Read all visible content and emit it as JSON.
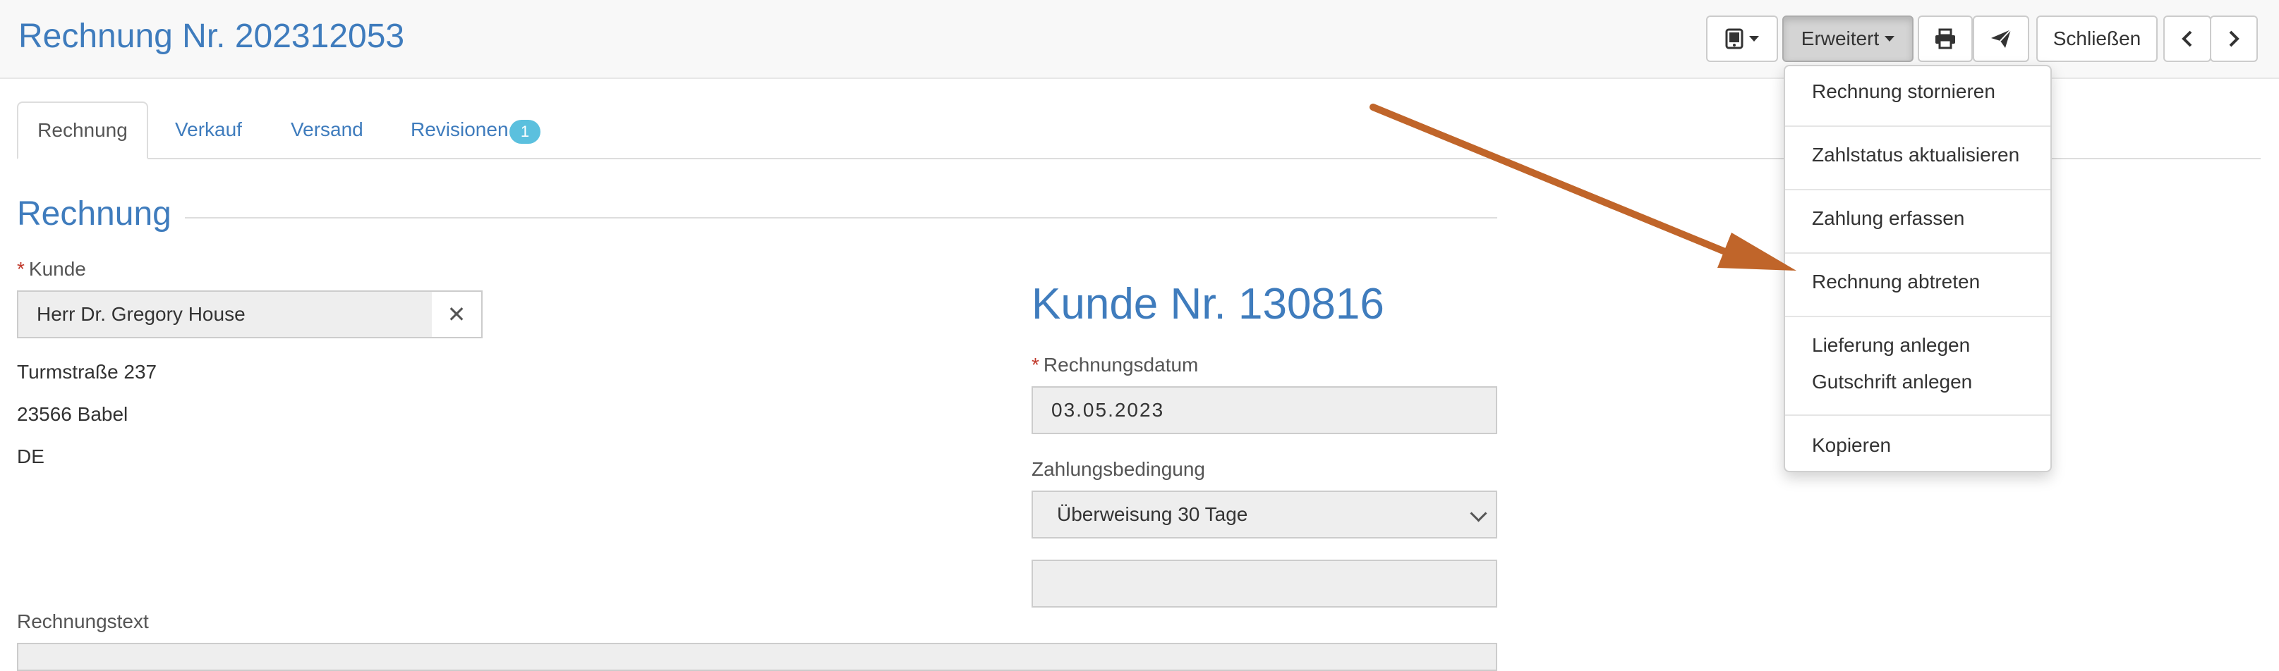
{
  "header": {
    "title": "Rechnung Nr. 202312053",
    "erweitert_label": "Erweitert",
    "close_label": "Schließen",
    "icons": [
      "tablet-icon",
      "print-icon",
      "send-icon",
      "chevron-left-icon",
      "chevron-right-icon"
    ]
  },
  "dropdown": {
    "items": [
      "Rechnung stornieren",
      "Zahlstatus aktualisieren",
      "Zahlung erfassen",
      "Rechnung abtreten",
      "Lieferung anlegen",
      "Gutschrift anlegen",
      "Kopieren"
    ]
  },
  "tabs": {
    "items": [
      "Rechnung",
      "Verkauf",
      "Versand",
      "Revisionen"
    ],
    "revisions_badge": "1"
  },
  "section": {
    "title": "Rechnung"
  },
  "form": {
    "customer_label": "Kunde",
    "customer_value": "Herr Dr. Gregory House",
    "address": [
      "Turmstraße 237",
      "23566 Babel",
      "DE"
    ],
    "customer_number": "Kunde Nr. 130816",
    "invoice_date_label": "Rechnungsdatum",
    "invoice_date_value": "03.05.2023",
    "payment_terms_label": "Zahlungsbedingung",
    "payment_terms_value": "Überweisung 30 Tage",
    "extra_field_value": "",
    "invoice_text_label": "Rechnungstext"
  },
  "colors": {
    "accent": "#3f7cbd",
    "badge": "#5bc0de",
    "annotation_arrow": "#c0652a",
    "required": "#c0392b"
  }
}
